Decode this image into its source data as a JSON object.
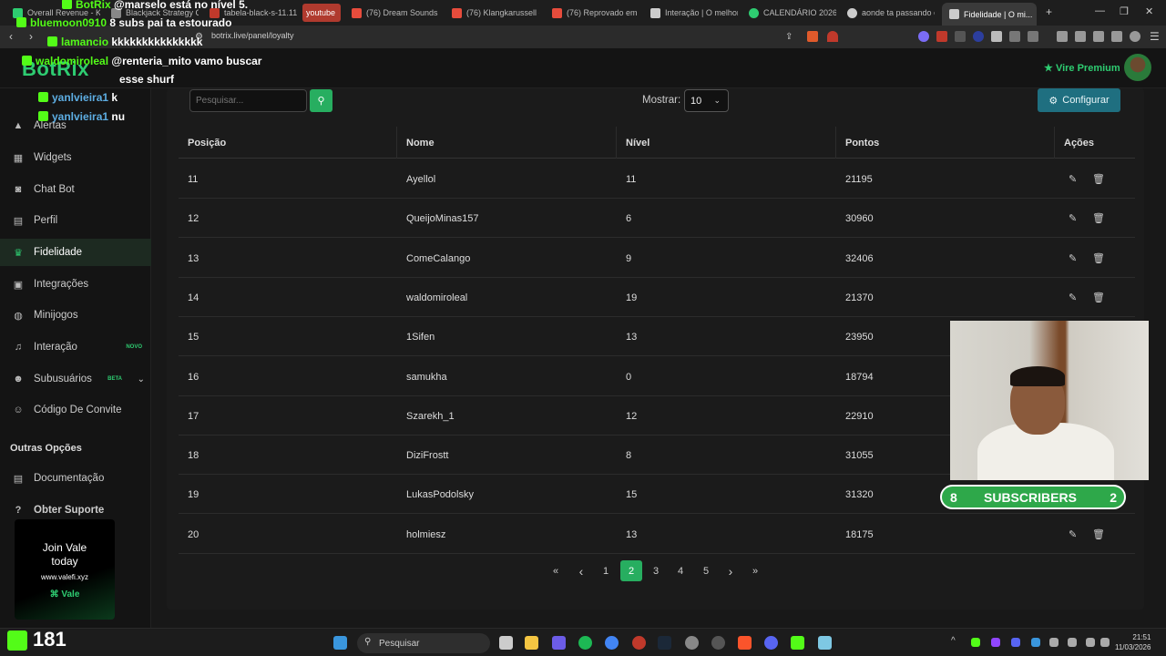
{
  "browser": {
    "tabs": [
      {
        "label": "Overall Revenue - K...",
        "color": "#2ecc71"
      },
      {
        "label": "Blackjack Strategy C...",
        "color": "#888888"
      },
      {
        "label": "tabela-black-s-11.11...",
        "color": "#c0392b"
      },
      {
        "label": "youtube",
        "color": "#c0392b"
      },
      {
        "label": "(76) Dream Sounds |...",
        "color": "#e74c3c"
      },
      {
        "label": "(76) Klangkarussell -...",
        "color": "#e74c3c"
      },
      {
        "label": "(76) Reprovado em to...",
        "color": "#e74c3c"
      },
      {
        "label": "Interação | O melhor...",
        "color": "#cccccc"
      },
      {
        "label": "CALENDÁRIO 2026 c...",
        "color": "#2ecc71"
      },
      {
        "label": "aonde ta passando o...",
        "color": "#cccccc"
      },
      {
        "label": "Fidelidade | O mi...",
        "color": "#cccccc"
      }
    ],
    "url": "botrix.live/panel/loyalty"
  },
  "header": {
    "logo": "BotRix",
    "premium": "Vire Premium"
  },
  "sidebar": {
    "items": [
      {
        "label": "Alertas",
        "icon": "alert-icon"
      },
      {
        "label": "Widgets",
        "icon": "widgets-icon"
      },
      {
        "label": "Chat Bot",
        "icon": "robot-icon"
      },
      {
        "label": "Perfil",
        "icon": "profile-icon"
      },
      {
        "label": "Fidelidade",
        "icon": "trophy-icon"
      },
      {
        "label": "Integrações",
        "icon": "integration-icon"
      },
      {
        "label": "Minijogos",
        "icon": "gamepad-icon"
      },
      {
        "label": "Interação",
        "icon": "music-icon",
        "badge": "NOVO"
      },
      {
        "label": "Subusuários",
        "icon": "users-icon",
        "badge": "BETA"
      },
      {
        "label": "Código De Convite",
        "icon": "invite-icon"
      }
    ],
    "section_other": "Outras Opções",
    "other_items": [
      {
        "label": "Documentação",
        "icon": "doc-icon"
      },
      {
        "label": "Obter Suporte",
        "icon": "help-icon"
      }
    ],
    "promo": {
      "line1": "Join Vale",
      "line2": "today",
      "url": "www.valefi.xyz",
      "brand": "Vale"
    }
  },
  "toolbar": {
    "search_placeholder": "Pesquisar...",
    "show_label": "Mostrar:",
    "show_value": "10",
    "config_label": "Configurar"
  },
  "table": {
    "columns": [
      "Posição",
      "Nome",
      "Nível",
      "Pontos",
      "Ações"
    ],
    "rows": [
      [
        "11",
        "Ayellol",
        "11",
        "21195"
      ],
      [
        "12",
        "QueijoMinas157",
        "6",
        "30960"
      ],
      [
        "13",
        "ComeCalango",
        "9",
        "32406"
      ],
      [
        "14",
        "waldomiroleal",
        "19",
        "21370"
      ],
      [
        "15",
        "1Sifen",
        "13",
        "23950"
      ],
      [
        "16",
        "samukha",
        "0",
        "18794"
      ],
      [
        "17",
        "Szarekh_1",
        "12",
        "22910"
      ],
      [
        "18",
        "DiziFrostt",
        "8",
        "31055"
      ],
      [
        "19",
        "LukasPodolsky",
        "15",
        "31320"
      ],
      [
        "20",
        "holmiesz",
        "13",
        "18175"
      ]
    ]
  },
  "pagination": {
    "first": "«",
    "prev": "‹",
    "pages": [
      "1",
      "2",
      "3",
      "4",
      "5"
    ],
    "current": "2",
    "next": "›",
    "last": "»"
  },
  "overlay": {
    "chat": [
      {
        "user": "BotRix",
        "msg": "@marselo está no nível 5.",
        "ucolor": "#53fc18"
      },
      {
        "user": "bluemoon0910",
        "msg": "8 subs pai ta estourado",
        "ucolor": "#53fc18"
      },
      {
        "user": "lamancio",
        "msg": "kkkkkkkkkkkkkkk",
        "ucolor": "#53fc18"
      },
      {
        "user": "waldomiroleal",
        "msg": "@renteria_mito vamo buscar",
        "ucolor": "#53fc18"
      },
      {
        "user": "",
        "msg": "esse shurf",
        "ucolor": "#53fc18"
      },
      {
        "user": "yanlvieira1",
        "msg": "k",
        "ucolor": "#5dade2"
      },
      {
        "user": "yanlvieira1",
        "msg": "nu",
        "ucolor": "#5dade2"
      }
    ],
    "subs_left": "8",
    "subs_label": "SUBSCRIBERS",
    "subs_right": "2",
    "kick_count": "181"
  },
  "taskbar": {
    "search": "Pesquisar",
    "time": "21:51",
    "date": "11/03/2026"
  }
}
